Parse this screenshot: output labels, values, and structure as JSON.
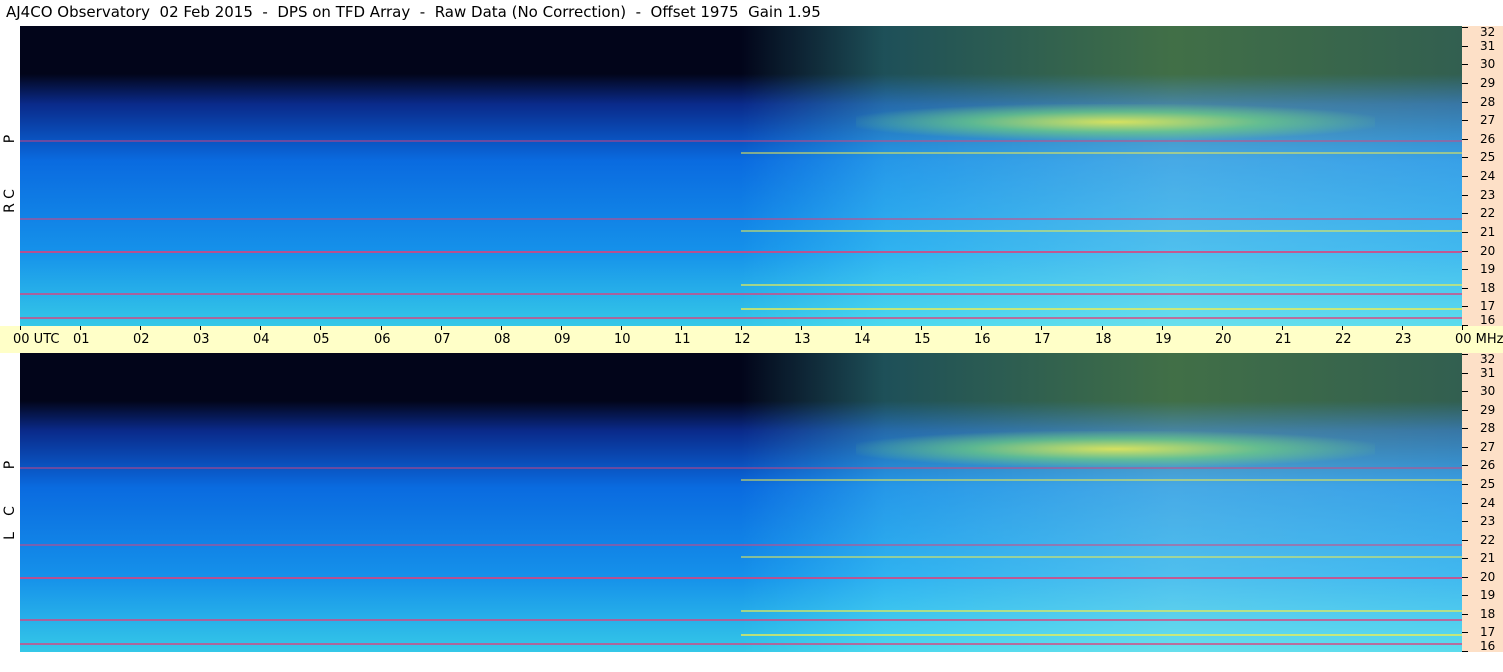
{
  "title": "AJ4CO Observatory  02 Feb 2015  -  DPS on TFD Array  -  Raw Data (No Correction)  -  Offset 1975  Gain 1.95",
  "panels": [
    {
      "polarization": "RCP",
      "letters": [
        "R",
        "C",
        "P"
      ]
    },
    {
      "polarization": "LCP",
      "letters": [
        "L",
        "C",
        "P"
      ]
    }
  ],
  "time_axis": {
    "labels": [
      "00 UTC",
      "01",
      "02",
      "03",
      "04",
      "05",
      "06",
      "07",
      "08",
      "09",
      "10",
      "11",
      "12",
      "13",
      "14",
      "15",
      "16",
      "17",
      "18",
      "19",
      "20",
      "21",
      "22",
      "23",
      "00 MHz"
    ]
  },
  "freq_axis": {
    "labels": [
      "32",
      "31",
      "30",
      "29",
      "28",
      "27",
      "26",
      "25",
      "24",
      "23",
      "22",
      "21",
      "20",
      "19",
      "18",
      "17",
      "16"
    ]
  },
  "colors": {
    "freq_axis_bg": "#fde0c7",
    "time_axis_bg": "#ffffc8",
    "spectro_dark": "#02051a",
    "spectro_blue": "#0a6be0",
    "spectro_cyan": "#35c8e8",
    "spectro_green": "#8ef06a",
    "spectro_yellow": "#f5f04a",
    "spectro_magenta": "#e0407a"
  }
}
